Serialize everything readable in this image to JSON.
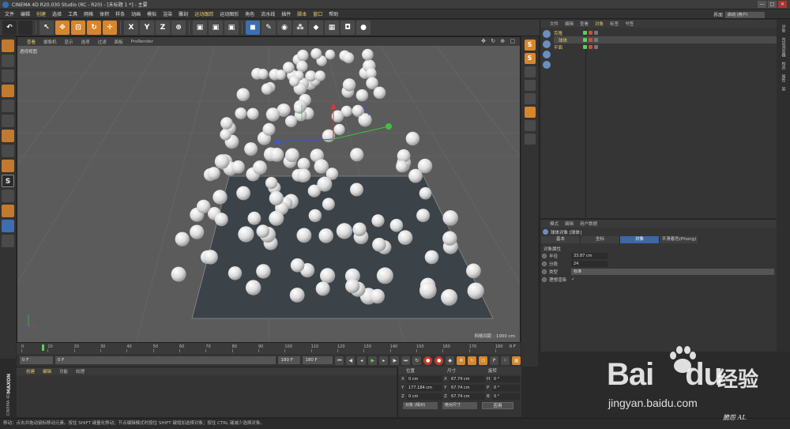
{
  "window": {
    "title": "CINEMA 4D R20.030 Studio (RC - R20) - [未标题 1 *] - 主要",
    "buttons": [
      "—",
      "□",
      "✕"
    ]
  },
  "menu": {
    "items": [
      "文件",
      "编辑",
      "创建",
      "选择",
      "工具",
      "网格",
      "体积",
      "样条",
      "动画",
      "模拟",
      "渲染",
      "雕刻",
      "运动跟踪",
      "运动图形",
      "角色",
      "流水线",
      "插件",
      "脚本",
      "窗口",
      "帮助"
    ],
    "layout_label": "界面",
    "layout_value": "启动 (用户)"
  },
  "toolbar": {
    "axis_x": "X",
    "axis_y": "Y",
    "axis_z": "Z"
  },
  "viewport": {
    "menu": [
      "查看",
      "摄像机",
      "显示",
      "选项",
      "过滤",
      "面板",
      "ProRender"
    ],
    "camera_label": "透视视图",
    "grid_label": "网格间距 : 1000 cm",
    "controls": "✥ ↻ ⊕ ▢"
  },
  "timeline": {
    "ticks": [
      "0",
      "10",
      "20",
      "30",
      "40",
      "50",
      "60",
      "70",
      "80",
      "90",
      "100",
      "110",
      "120",
      "130",
      "140",
      "150",
      "160",
      "170",
      "180"
    ],
    "end_frame": "0 F",
    "current_frame": "0 F",
    "start_field": "0 F",
    "end_field": "180 F",
    "end_field2": "180 F"
  },
  "materials": {
    "tabs": [
      "创建",
      "编辑",
      "功能",
      "纹理"
    ],
    "brand": "MAXON",
    "brand2": "CINEMA 4D"
  },
  "coords": {
    "headers": [
      "位置",
      "尺寸",
      "旋转"
    ],
    "rows": [
      {
        "p_axis": "X",
        "p_val": "0 cm",
        "s_axis": "X",
        "s_val": "67.74 cm",
        "r_axis": "H",
        "r_val": "0 °"
      },
      {
        "p_axis": "Y",
        "p_val": "177.184 cm",
        "s_axis": "Y",
        "s_val": "67.74 cm",
        "r_axis": "P",
        "r_val": "0 °"
      },
      {
        "p_axis": "Z",
        "p_val": "0 cm",
        "s_axis": "Z",
        "s_val": "67.74 cm",
        "r_axis": "B",
        "r_val": "0 °"
      }
    ],
    "mode_select": "对象 (相对)",
    "size_select": "绝对尺寸",
    "apply": "应用"
  },
  "objects": {
    "tabs": [
      "文件",
      "编辑",
      "查看",
      "对象",
      "标签",
      "书签"
    ],
    "items": [
      {
        "name": "克隆"
      },
      {
        "name": "球体"
      },
      {
        "name": "平面"
      }
    ]
  },
  "right_tabs": [
    "对象",
    "内容浏览器",
    "构造",
    "属性",
    "层"
  ],
  "attributes": {
    "menu": [
      "模式",
      "编辑",
      "用户数据"
    ],
    "title": "球体对象 [球体]",
    "tabs": [
      "基本",
      "坐标",
      "对象",
      "平滑着色(Phong)"
    ],
    "section": "对象属性",
    "radius_label": "半径",
    "radius_value": "33.87 cm",
    "segments_label": "分段",
    "segments_value": "24",
    "type_label": "类型",
    "type_value": "标准",
    "render_perfect_label": "理想渲染",
    "render_perfect_value": "✓"
  },
  "statusbar": {
    "text": "移动：点击并拖动鼠标移动元素。按住 SHIFT 键量化移动；节点编辑模式时按住 SHIFT 键增加选择对象；按住 CTRL 键减少选择对象。"
  },
  "watermark": {
    "logo_a": "Bai",
    "logo_b": "du",
    "cn": "经验",
    "url": "jingyan.baidu.com",
    "signature": "脆怨 AL"
  },
  "colors": {
    "accent": "#d7862c",
    "selection_blue": "#3c67a8",
    "viewport_bg": "#5b5b5b",
    "plane": "#3b4349"
  }
}
